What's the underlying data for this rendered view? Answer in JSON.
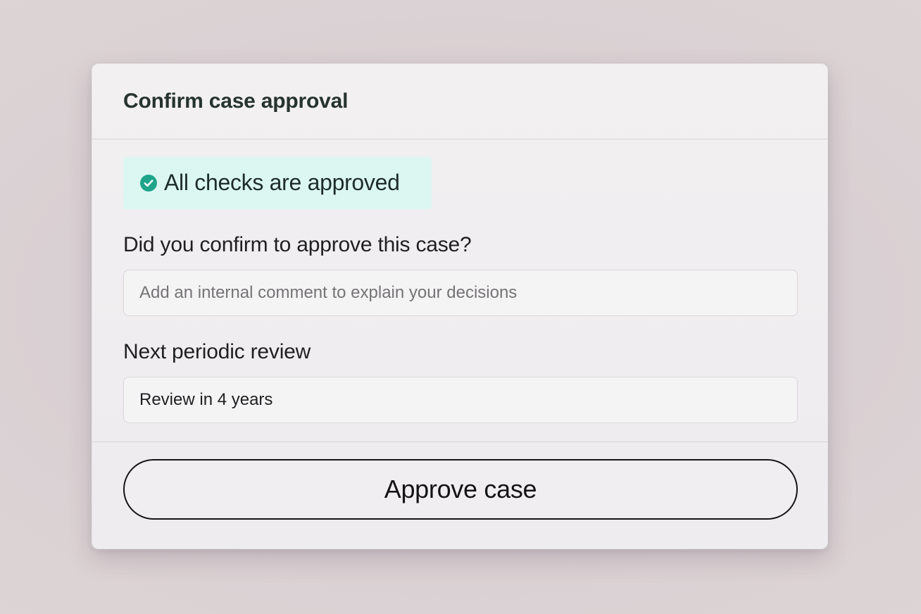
{
  "modal": {
    "title": "Confirm case approval"
  },
  "status": {
    "text": "All checks are approved",
    "icon": "check-circle-icon",
    "icon_color": "#1fa48b",
    "background_color": "#dcf7f1"
  },
  "confirm_section": {
    "label": "Did you confirm to approve this case?",
    "comment_placeholder": "Add an internal comment to explain your decisions",
    "comment_value": ""
  },
  "review_section": {
    "label": "Next periodic review",
    "selected_value": "Review in 4 years"
  },
  "actions": {
    "approve_label": "Approve case"
  }
}
